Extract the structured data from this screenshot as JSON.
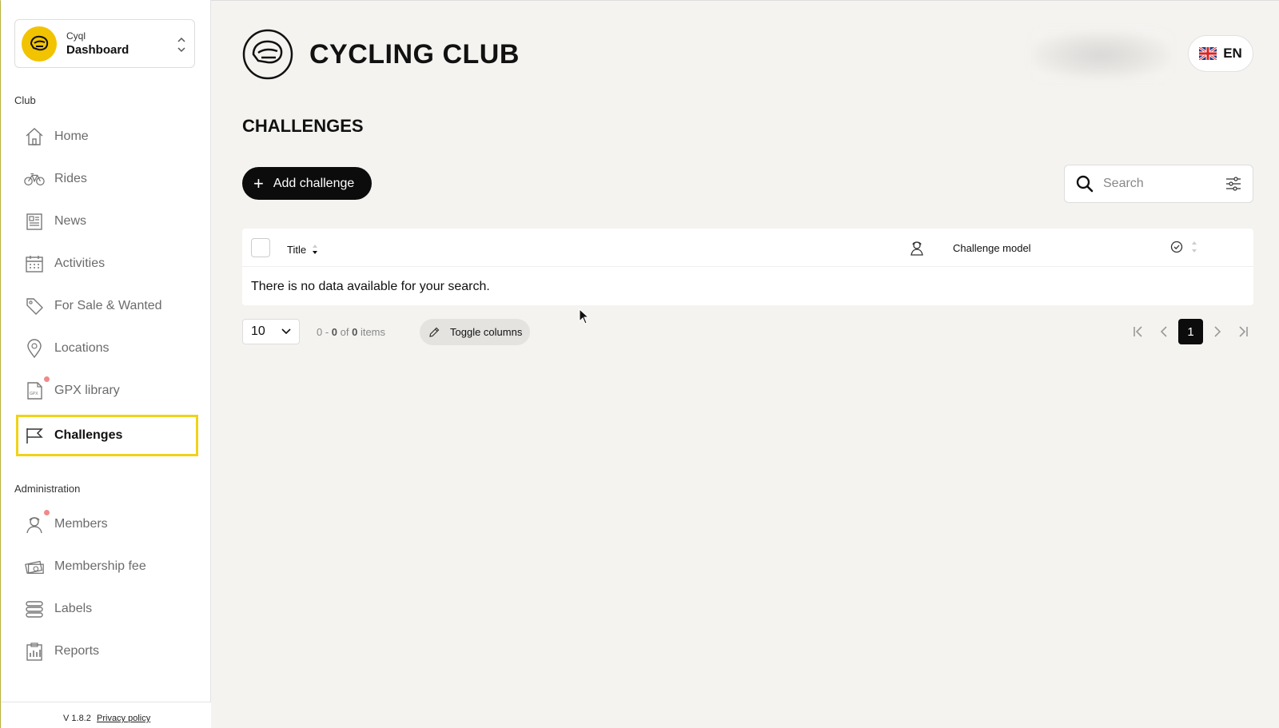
{
  "app": {
    "product": "Cyql",
    "section": "Dashboard"
  },
  "sidebar": {
    "club_label": "Club",
    "club_items": [
      {
        "label": "Home",
        "icon": "home-icon"
      },
      {
        "label": "Rides",
        "icon": "bicycle-icon"
      },
      {
        "label": "News",
        "icon": "newspaper-icon"
      },
      {
        "label": "Activities",
        "icon": "calendar-icon"
      },
      {
        "label": "For Sale & Wanted",
        "icon": "tag-icon"
      },
      {
        "label": "Locations",
        "icon": "location-pin-icon"
      },
      {
        "label": "GPX library",
        "icon": "gpx-file-icon",
        "notification": true
      },
      {
        "label": "Challenges",
        "icon": "flag-icon",
        "active": true
      }
    ],
    "admin_label": "Administration",
    "admin_items": [
      {
        "label": "Members",
        "icon": "member-icon",
        "notification": true
      },
      {
        "label": "Membership fee",
        "icon": "money-icon"
      },
      {
        "label": "Labels",
        "icon": "labels-icon"
      },
      {
        "label": "Reports",
        "icon": "reports-icon"
      }
    ],
    "version": "V 1.8.2",
    "privacy": "Privacy policy"
  },
  "header": {
    "club_name": "CYCLING CLUB",
    "language": "EN"
  },
  "page": {
    "title": "CHALLENGES",
    "add_button": "Add challenge",
    "search_placeholder": "Search"
  },
  "table": {
    "columns": [
      "Title",
      "Challenge model"
    ],
    "empty_message": "There is no data available for your search."
  },
  "pagination": {
    "page_size": "10",
    "range_prefix": "0 - ",
    "range_mid": "0",
    "range_of": " of ",
    "range_total": "0",
    "range_suffix": " items",
    "toggle_columns": "Toggle columns",
    "current_page": "1"
  },
  "colors": {
    "accent": "#f0d219",
    "brand_yellow": "#f2c300",
    "primary_button": "#0c0c0c",
    "notification": "#f08a8a"
  }
}
